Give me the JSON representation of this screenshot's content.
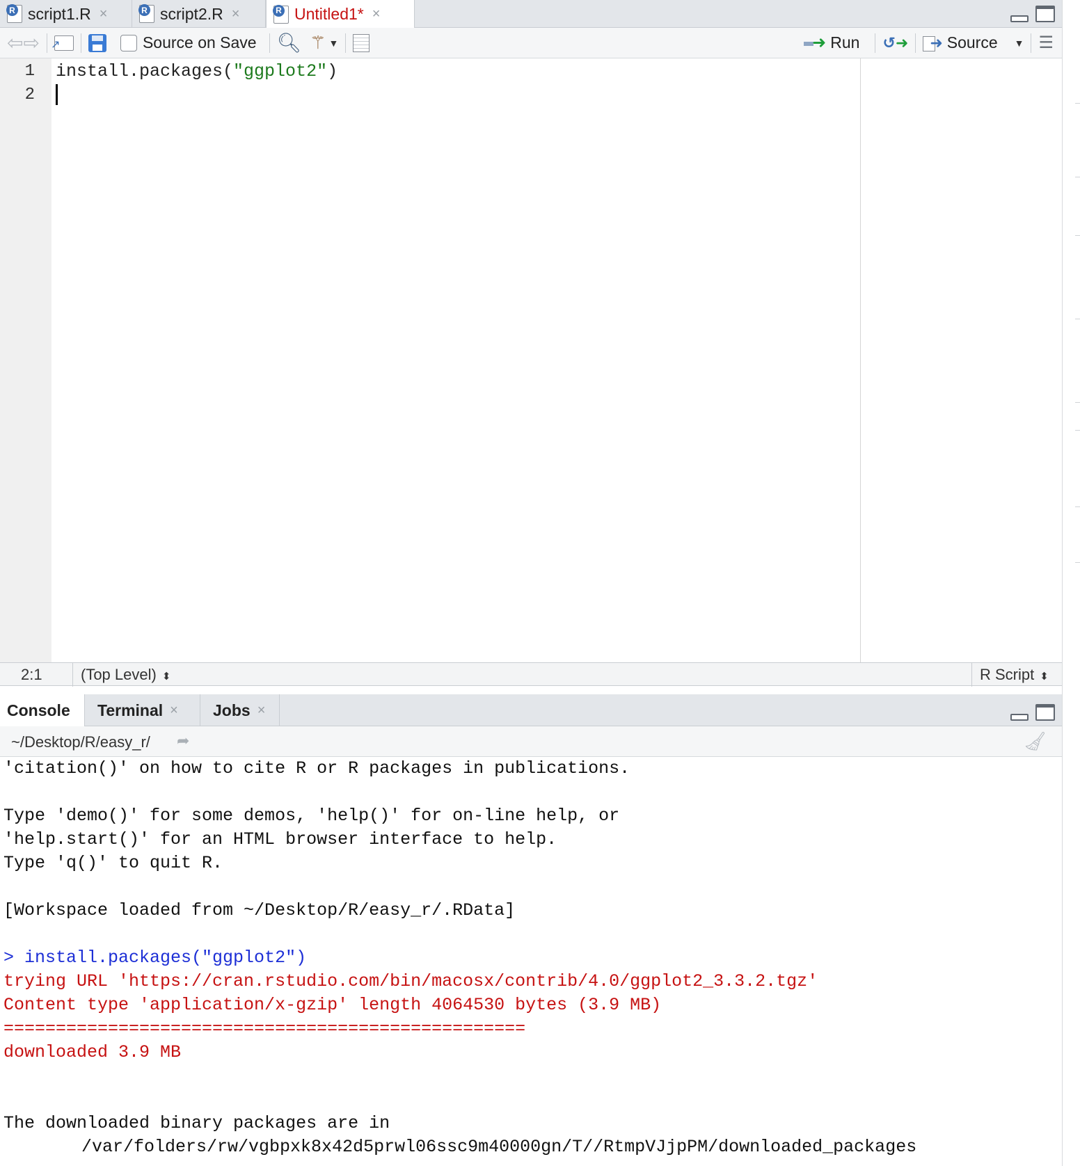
{
  "editor": {
    "tabs": [
      {
        "label": "script1.R",
        "active": false
      },
      {
        "label": "script2.R",
        "active": false
      },
      {
        "label": "Untitled1*",
        "active": true
      }
    ],
    "toolbar": {
      "source_on_save_label": "Source on Save",
      "run_label": "Run",
      "source_label": "Source"
    },
    "line_numbers": [
      "1",
      "2"
    ],
    "code": {
      "line1_fn": "install.packages(",
      "line1_str": "\"ggplot2\"",
      "line1_end": ")"
    },
    "status": {
      "cursor_position": "2:1",
      "scope": "(Top Level)",
      "file_type": "R Script"
    }
  },
  "console": {
    "tabs": [
      {
        "label": "Console",
        "active": true
      },
      {
        "label": "Terminal",
        "active": false
      },
      {
        "label": "Jobs",
        "active": false
      }
    ],
    "working_directory": "~/Desktop/R/easy_r/",
    "output": [
      {
        "text": "'citation()' on how to cite R or R packages in publications.",
        "kind": "normal"
      },
      {
        "text": "",
        "kind": "normal"
      },
      {
        "text": "Type 'demo()' for some demos, 'help()' for on-line help, or",
        "kind": "normal"
      },
      {
        "text": "'help.start()' for an HTML browser interface to help.",
        "kind": "normal"
      },
      {
        "text": "Type 'q()' to quit R.",
        "kind": "normal"
      },
      {
        "text": "",
        "kind": "normal"
      },
      {
        "text": "[Workspace loaded from ~/Desktop/R/easy_r/.RData]",
        "kind": "normal"
      },
      {
        "text": "",
        "kind": "normal"
      },
      {
        "text": "> install.packages(\"ggplot2\")",
        "kind": "cmd"
      },
      {
        "text": "trying URL 'https://cran.rstudio.com/bin/macosx/contrib/4.0/ggplot2_3.3.2.tgz'",
        "kind": "err"
      },
      {
        "text": "Content type 'application/x-gzip' length 4064530 bytes (3.9 MB)",
        "kind": "err"
      },
      {
        "text": "==================================================",
        "kind": "err"
      },
      {
        "text": "downloaded 3.9 MB",
        "kind": "err"
      },
      {
        "text": "",
        "kind": "normal"
      },
      {
        "text": "",
        "kind": "normal"
      },
      {
        "text": "The downloaded binary packages are in",
        "kind": "normal"
      },
      {
        "text": "/var/folders/rw/vgbpxk8x42d5prwl06ssc9m40000gn/T//RtmpVJjpPM/downloaded_packages",
        "kind": "indent"
      }
    ]
  },
  "colors": {
    "active_tab_text": "#c61212",
    "console_command": "#1d2fd6",
    "console_stderr": "#c61212",
    "string_literal": "#1d7a1d",
    "run_arrow": "#1e9e3a"
  }
}
